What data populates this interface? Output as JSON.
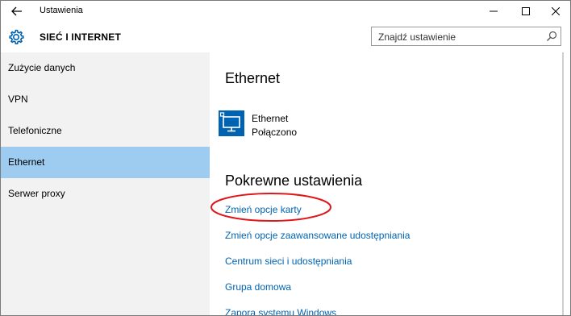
{
  "window": {
    "title": "Ustawienia",
    "back_icon": "arrow-left-icon",
    "controls": [
      "minimize-icon",
      "maximize-icon",
      "close-icon"
    ]
  },
  "header": {
    "icon": "gear-icon",
    "title": "SIEĆ I INTERNET",
    "search_placeholder": "Znajdź ustawienie",
    "search_icon": "search-icon"
  },
  "sidebar": {
    "items": [
      {
        "label": "Zużycie danych",
        "active": false
      },
      {
        "label": "VPN",
        "active": false
      },
      {
        "label": "Telefoniczne",
        "active": false
      },
      {
        "label": "Ethernet",
        "active": true
      },
      {
        "label": "Serwer proxy",
        "active": false
      }
    ]
  },
  "main": {
    "heading": "Ethernet",
    "connection": {
      "icon": "ethernet-monitor-icon",
      "name": "Ethernet",
      "status": "Połączono"
    },
    "related_heading": "Pokrewne ustawienia",
    "links": [
      "Zmień opcje karty",
      "Zmień opcje zaawansowane udostępniania",
      "Centrum sieci i udostępniania",
      "Grupa domowa",
      "Zapora systemu Windows"
    ]
  },
  "colors": {
    "accent": "#0063b1",
    "active_item": "#9ecbf0",
    "sidebar_bg": "#f2f2f2",
    "annotation": "#e0161b"
  }
}
